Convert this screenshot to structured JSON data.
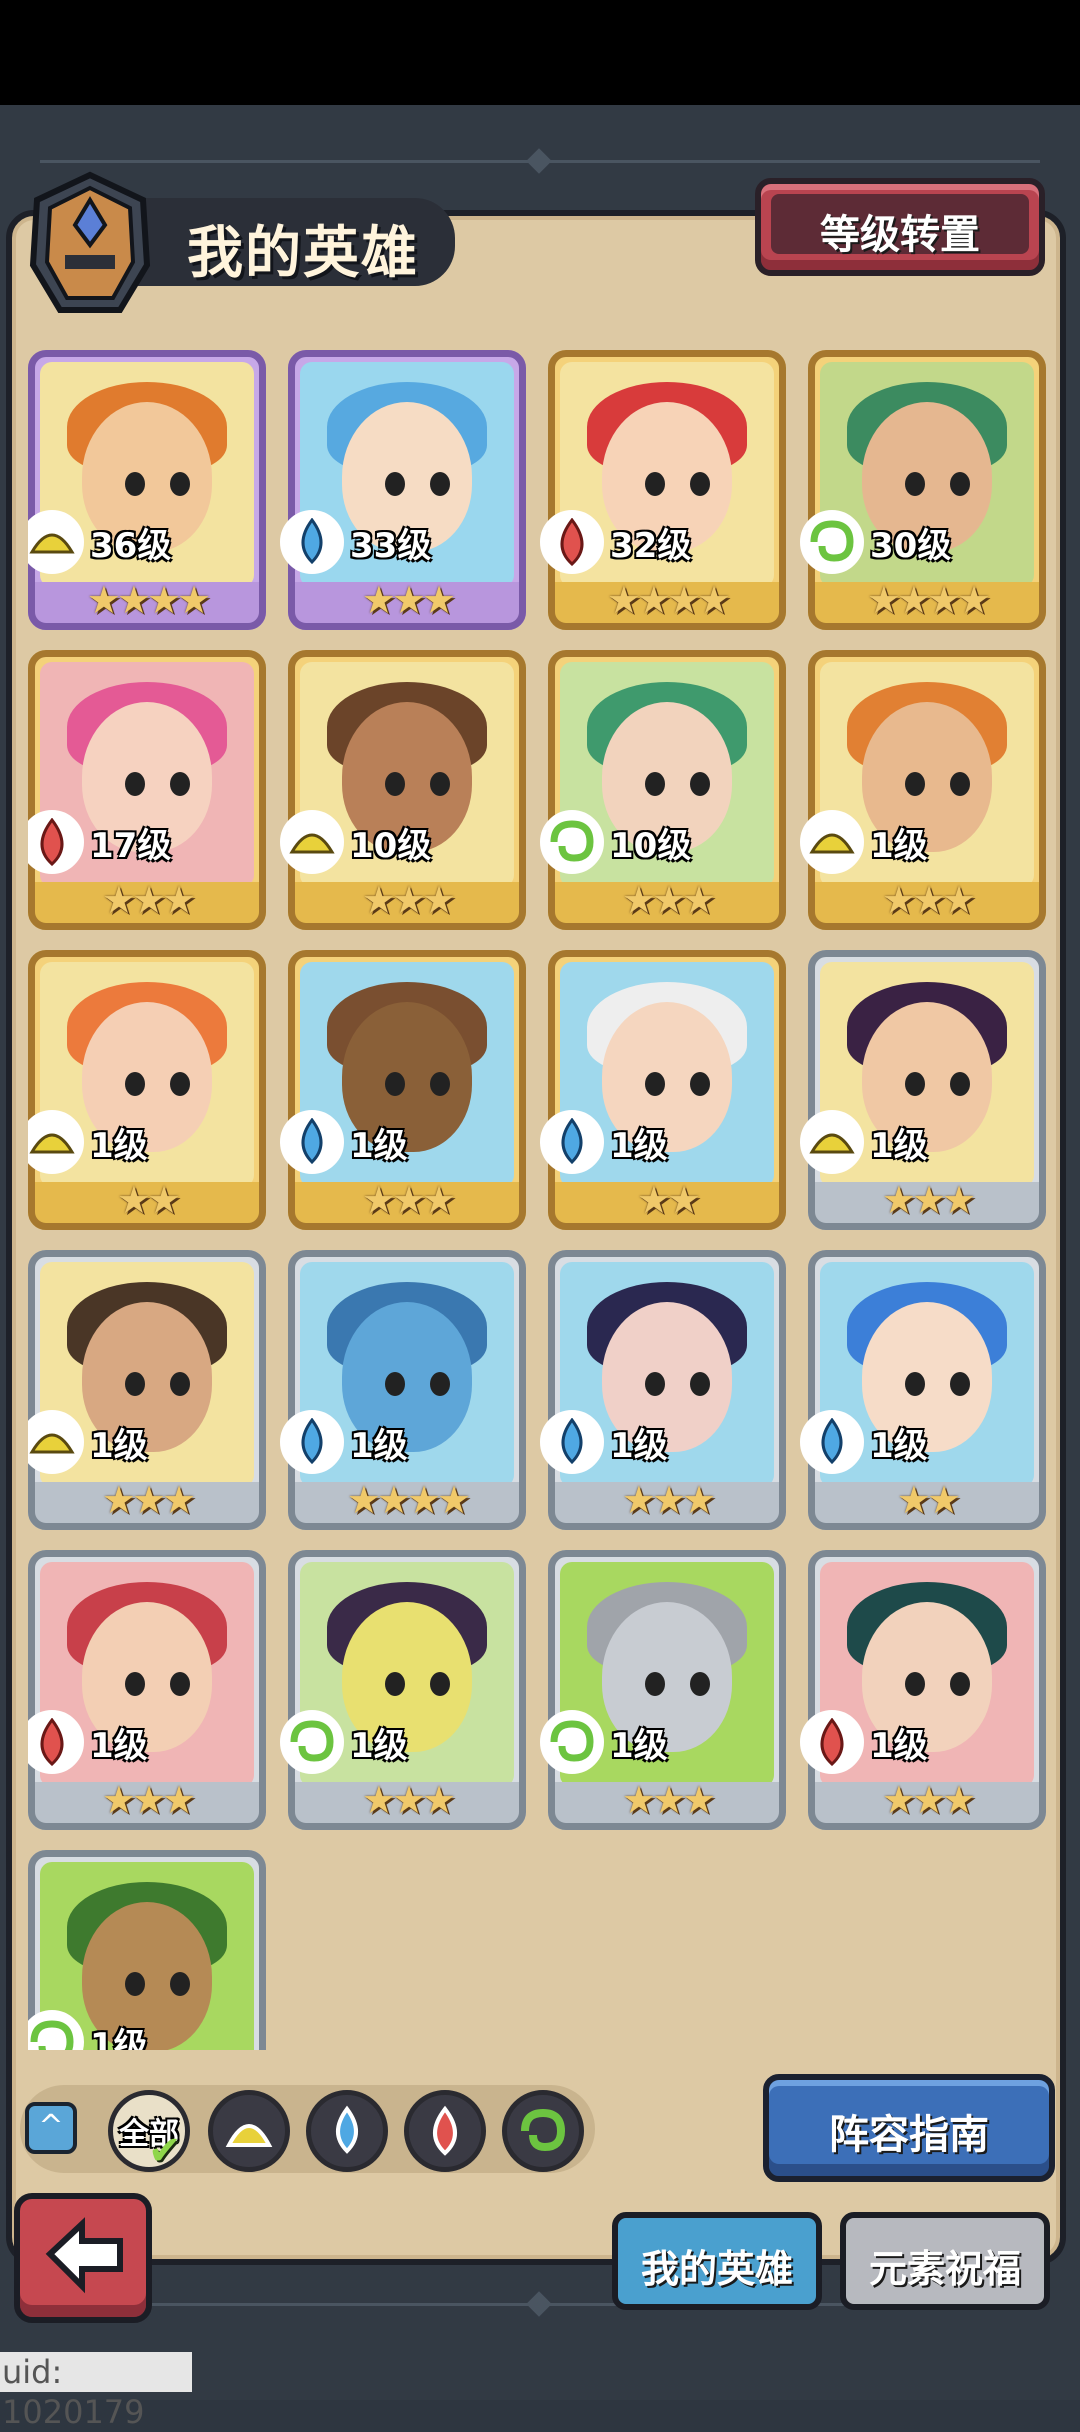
{
  "header": {
    "title": "我的英雄",
    "level_transfer_label": "等级转置"
  },
  "heroes": [
    {
      "level": "36级",
      "stars": "★★★★",
      "element": "earth",
      "frame": "purple",
      "bg": "#f3e3a0",
      "hair": "#e07b2e",
      "skin": "#f2c89a"
    },
    {
      "level": "33级",
      "stars": "★★★",
      "element": "water",
      "frame": "purple",
      "bg": "#9ad7ee",
      "hair": "#57a9e0",
      "skin": "#f6dcc4"
    },
    {
      "level": "32级",
      "stars": "★★★★",
      "element": "fire",
      "frame": "gold",
      "bg": "#f4e3a0",
      "hair": "#d83b3b",
      "skin": "#f7d3b7"
    },
    {
      "level": "30级",
      "stars": "★★★★",
      "element": "wind",
      "frame": "gold",
      "bg": "#c2d88a",
      "hair": "#3c8b60",
      "skin": "#e5b790"
    },
    {
      "level": "17级",
      "stars": "★★★",
      "element": "fire",
      "frame": "gold",
      "bg": "#f0b5b5",
      "hair": "#e45a95",
      "skin": "#f6d2c0"
    },
    {
      "level": "10级",
      "stars": "★★★",
      "element": "earth",
      "frame": "gold",
      "bg": "#f3e3a0",
      "hair": "#6b4429",
      "skin": "#b98058"
    },
    {
      "level": "10级",
      "stars": "★★★",
      "element": "wind",
      "frame": "gold",
      "bg": "#c8e2a0",
      "hair": "#3f9a6d",
      "skin": "#f2d3bd"
    },
    {
      "level": "1级",
      "stars": "★★★",
      "element": "earth",
      "frame": "gold",
      "bg": "#f3e3a0",
      "hair": "#e18033",
      "skin": "#e8b98e"
    },
    {
      "level": "1级",
      "stars": "★★",
      "element": "earth",
      "frame": "gold",
      "bg": "#f3e3a0",
      "hair": "#ec7a3c",
      "skin": "#f5cfb4"
    },
    {
      "level": "1级",
      "stars": "★★★",
      "element": "water",
      "frame": "gold",
      "bg": "#9fd8ec",
      "hair": "#7a4f30",
      "skin": "#8a6038"
    },
    {
      "level": "1级",
      "stars": "★★",
      "element": "water",
      "frame": "gold",
      "bg": "#9fd8ec",
      "hair": "#eeeeee",
      "skin": "#f5d6bf"
    },
    {
      "level": "1级",
      "stars": "★★★",
      "element": "earth",
      "frame": "silver",
      "bg": "#f3e3a0",
      "hair": "#3a2244",
      "skin": "#f0c8a4"
    },
    {
      "level": "1级",
      "stars": "★★★",
      "element": "earth",
      "frame": "silver",
      "bg": "#f3e3a0",
      "hair": "#4a3626",
      "skin": "#d8a882"
    },
    {
      "level": "1级",
      "stars": "★★★★",
      "element": "water",
      "frame": "silver",
      "bg": "#9fd8ec",
      "hair": "#3a78b0",
      "skin": "#5ea6d8"
    },
    {
      "level": "1级",
      "stars": "★★★",
      "element": "water",
      "frame": "silver",
      "bg": "#9fd8ec",
      "hair": "#2a2850",
      "skin": "#f0d0c8"
    },
    {
      "level": "1级",
      "stars": "★★",
      "element": "water",
      "frame": "silver",
      "bg": "#9fd8ec",
      "hair": "#3c7fd8",
      "skin": "#f6dcc8"
    },
    {
      "level": "1级",
      "stars": "★★★",
      "element": "fire",
      "frame": "silver",
      "bg": "#f0b5b5",
      "hair": "#c8404a",
      "skin": "#f3cfb4"
    },
    {
      "level": "1级",
      "stars": "★★★",
      "element": "wind",
      "frame": "silver",
      "bg": "#c8e2a0",
      "hair": "#3a2a48",
      "skin": "#e8e070"
    },
    {
      "level": "1级",
      "stars": "★★★",
      "element": "wind",
      "frame": "silver",
      "bg": "#a8d860",
      "hair": "#a0a4aa",
      "skin": "#c8ccd2"
    },
    {
      "level": "1级",
      "stars": "★★★",
      "element": "fire",
      "frame": "silver",
      "bg": "#f0b5b5",
      "hair": "#1e4a4a",
      "skin": "#f2d2bc"
    },
    {
      "level": "1级",
      "stars": "★★★",
      "element": "wind",
      "frame": "silver",
      "bg": "#a8d860",
      "hair": "#3e7a2e",
      "skin": "#b58a55"
    }
  ],
  "filters": {
    "expand_icon": "chevron-up-icon",
    "all_label": "全部",
    "elements": [
      "earth",
      "water",
      "fire",
      "wind"
    ]
  },
  "lineup_guide_label": "阵容指南",
  "tabs": {
    "my_heroes": "我的英雄",
    "element_blessing": "元素祝福"
  },
  "uid": "uid: 1020179",
  "colors": {
    "earth": "#e8d13a",
    "water": "#4fa8e3",
    "fire": "#e0524e",
    "wind": "#6cc440"
  }
}
